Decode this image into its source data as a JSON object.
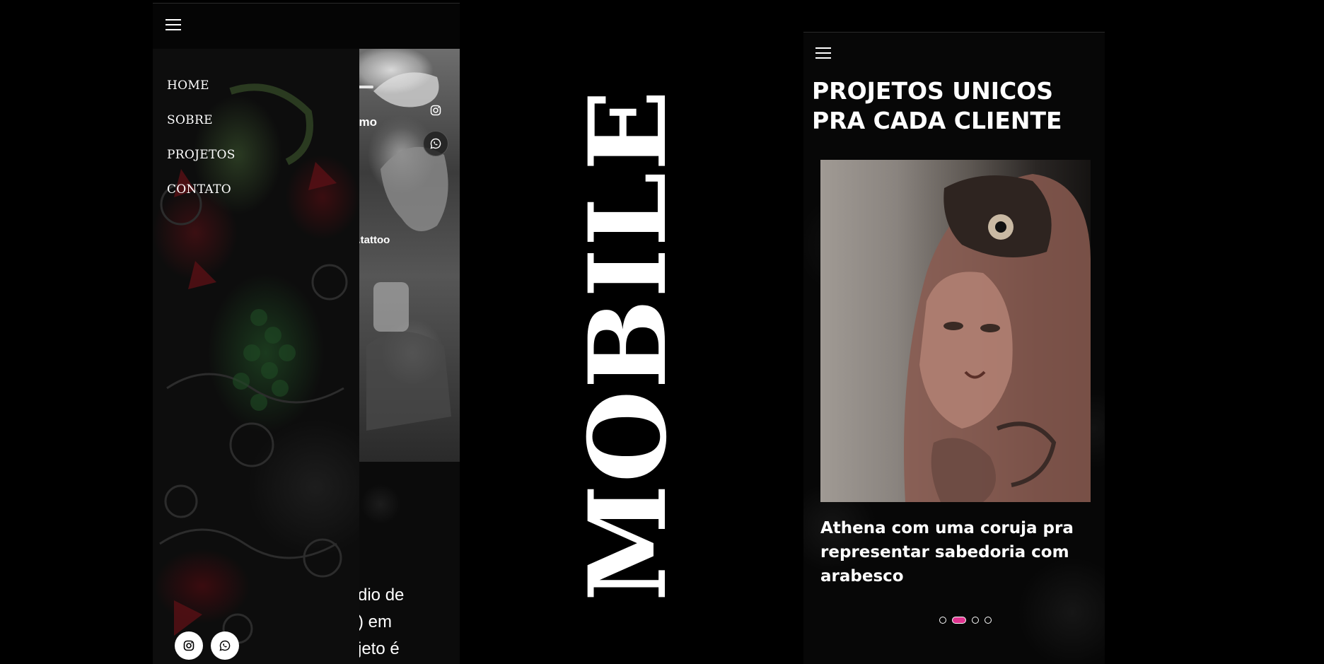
{
  "left_phone": {
    "menu_items": [
      {
        "label": "HOME"
      },
      {
        "label": "SOBRE"
      },
      {
        "label": "PROJETOS"
      },
      {
        "label": "CONTATO"
      }
    ],
    "hero_partial_texts": [
      "smo",
      "z.tattoo"
    ],
    "hero_paragraph_partial": "dio de\n) em\njeto é",
    "social_buttons": [
      {
        "icon": "instagram-icon"
      },
      {
        "icon": "whatsapp-icon"
      }
    ]
  },
  "center_title": "MOBILE",
  "right_phone": {
    "heading": "PROJETOS UNICOS PRA CADA CLIENTE",
    "slide_caption": "Athena com uma coruja pra representar sabedoria com arabesco",
    "slides_total": 4,
    "active_slide_index": 1
  },
  "colors": {
    "background": "#000000",
    "accent": "#e0338f",
    "text": "#ffffff"
  }
}
